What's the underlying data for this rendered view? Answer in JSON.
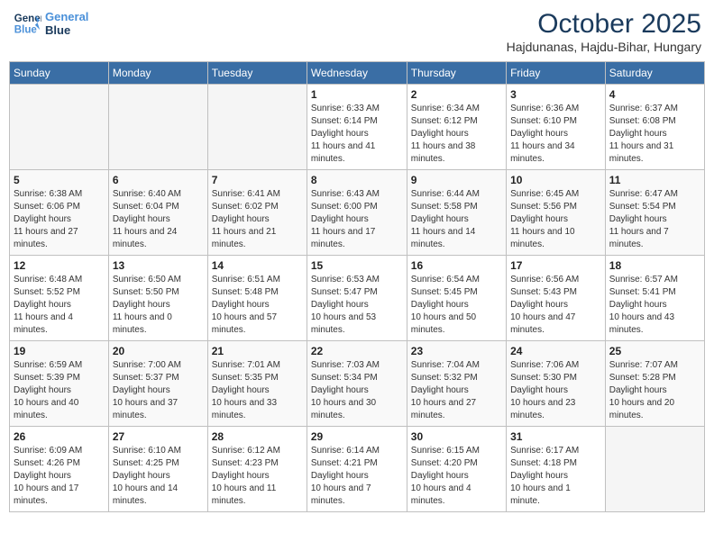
{
  "header": {
    "logo_line1": "General",
    "logo_line2": "Blue",
    "month_title": "October 2025",
    "subtitle": "Hajdunanas, Hajdu-Bihar, Hungary"
  },
  "weekdays": [
    "Sunday",
    "Monday",
    "Tuesday",
    "Wednesday",
    "Thursday",
    "Friday",
    "Saturday"
  ],
  "weeks": [
    [
      {
        "day": "",
        "empty": true
      },
      {
        "day": "",
        "empty": true
      },
      {
        "day": "",
        "empty": true
      },
      {
        "day": "1",
        "sunrise": "6:33 AM",
        "sunset": "6:14 PM",
        "daylight": "11 hours and 41 minutes."
      },
      {
        "day": "2",
        "sunrise": "6:34 AM",
        "sunset": "6:12 PM",
        "daylight": "11 hours and 38 minutes."
      },
      {
        "day": "3",
        "sunrise": "6:36 AM",
        "sunset": "6:10 PM",
        "daylight": "11 hours and 34 minutes."
      },
      {
        "day": "4",
        "sunrise": "6:37 AM",
        "sunset": "6:08 PM",
        "daylight": "11 hours and 31 minutes."
      }
    ],
    [
      {
        "day": "5",
        "sunrise": "6:38 AM",
        "sunset": "6:06 PM",
        "daylight": "11 hours and 27 minutes."
      },
      {
        "day": "6",
        "sunrise": "6:40 AM",
        "sunset": "6:04 PM",
        "daylight": "11 hours and 24 minutes."
      },
      {
        "day": "7",
        "sunrise": "6:41 AM",
        "sunset": "6:02 PM",
        "daylight": "11 hours and 21 minutes."
      },
      {
        "day": "8",
        "sunrise": "6:43 AM",
        "sunset": "6:00 PM",
        "daylight": "11 hours and 17 minutes."
      },
      {
        "day": "9",
        "sunrise": "6:44 AM",
        "sunset": "5:58 PM",
        "daylight": "11 hours and 14 minutes."
      },
      {
        "day": "10",
        "sunrise": "6:45 AM",
        "sunset": "5:56 PM",
        "daylight": "11 hours and 10 minutes."
      },
      {
        "day": "11",
        "sunrise": "6:47 AM",
        "sunset": "5:54 PM",
        "daylight": "11 hours and 7 minutes."
      }
    ],
    [
      {
        "day": "12",
        "sunrise": "6:48 AM",
        "sunset": "5:52 PM",
        "daylight": "11 hours and 4 minutes."
      },
      {
        "day": "13",
        "sunrise": "6:50 AM",
        "sunset": "5:50 PM",
        "daylight": "11 hours and 0 minutes."
      },
      {
        "day": "14",
        "sunrise": "6:51 AM",
        "sunset": "5:48 PM",
        "daylight": "10 hours and 57 minutes."
      },
      {
        "day": "15",
        "sunrise": "6:53 AM",
        "sunset": "5:47 PM",
        "daylight": "10 hours and 53 minutes."
      },
      {
        "day": "16",
        "sunrise": "6:54 AM",
        "sunset": "5:45 PM",
        "daylight": "10 hours and 50 minutes."
      },
      {
        "day": "17",
        "sunrise": "6:56 AM",
        "sunset": "5:43 PM",
        "daylight": "10 hours and 47 minutes."
      },
      {
        "day": "18",
        "sunrise": "6:57 AM",
        "sunset": "5:41 PM",
        "daylight": "10 hours and 43 minutes."
      }
    ],
    [
      {
        "day": "19",
        "sunrise": "6:59 AM",
        "sunset": "5:39 PM",
        "daylight": "10 hours and 40 minutes."
      },
      {
        "day": "20",
        "sunrise": "7:00 AM",
        "sunset": "5:37 PM",
        "daylight": "10 hours and 37 minutes."
      },
      {
        "day": "21",
        "sunrise": "7:01 AM",
        "sunset": "5:35 PM",
        "daylight": "10 hours and 33 minutes."
      },
      {
        "day": "22",
        "sunrise": "7:03 AM",
        "sunset": "5:34 PM",
        "daylight": "10 hours and 30 minutes."
      },
      {
        "day": "23",
        "sunrise": "7:04 AM",
        "sunset": "5:32 PM",
        "daylight": "10 hours and 27 minutes."
      },
      {
        "day": "24",
        "sunrise": "7:06 AM",
        "sunset": "5:30 PM",
        "daylight": "10 hours and 23 minutes."
      },
      {
        "day": "25",
        "sunrise": "7:07 AM",
        "sunset": "5:28 PM",
        "daylight": "10 hours and 20 minutes."
      }
    ],
    [
      {
        "day": "26",
        "sunrise": "6:09 AM",
        "sunset": "4:26 PM",
        "daylight": "10 hours and 17 minutes."
      },
      {
        "day": "27",
        "sunrise": "6:10 AM",
        "sunset": "4:25 PM",
        "daylight": "10 hours and 14 minutes."
      },
      {
        "day": "28",
        "sunrise": "6:12 AM",
        "sunset": "4:23 PM",
        "daylight": "10 hours and 11 minutes."
      },
      {
        "day": "29",
        "sunrise": "6:14 AM",
        "sunset": "4:21 PM",
        "daylight": "10 hours and 7 minutes."
      },
      {
        "day": "30",
        "sunrise": "6:15 AM",
        "sunset": "4:20 PM",
        "daylight": "10 hours and 4 minutes."
      },
      {
        "day": "31",
        "sunrise": "6:17 AM",
        "sunset": "4:18 PM",
        "daylight": "10 hours and 1 minute."
      },
      {
        "day": "",
        "empty": true
      }
    ]
  ]
}
